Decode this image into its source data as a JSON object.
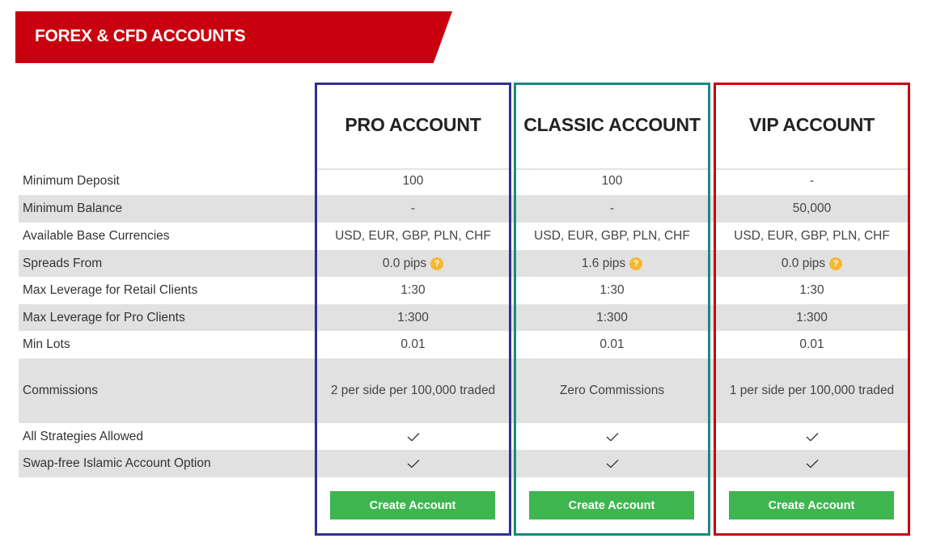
{
  "banner": {
    "title": "FOREX & CFD ACCOUNTS",
    "color": "#c9000f"
  },
  "rows": [
    {
      "key": "min_deposit",
      "label": "Minimum Deposit"
    },
    {
      "key": "min_balance",
      "label": "Minimum Balance"
    },
    {
      "key": "currencies",
      "label": "Available Base Currencies"
    },
    {
      "key": "spreads",
      "label": "Spreads From"
    },
    {
      "key": "lev_retail",
      "label": "Max Leverage for Retail Clients"
    },
    {
      "key": "lev_pro",
      "label": "Max Leverage for Pro Clients"
    },
    {
      "key": "min_lots",
      "label": "Min Lots"
    },
    {
      "key": "commissions",
      "label": "Commissions"
    },
    {
      "key": "strategies",
      "label": "All Strategies Allowed"
    },
    {
      "key": "swap_free",
      "label": "Swap-free Islamic Account Option"
    }
  ],
  "accounts": [
    {
      "id": "pro",
      "title": "PRO ACCOUNT",
      "border_color": "#2e3192",
      "values": {
        "min_deposit": "100",
        "min_balance": "-",
        "currencies": "USD, EUR, GBP, PLN, CHF",
        "spreads": "0.0 pips",
        "lev_retail": "1:30",
        "lev_pro": "1:300",
        "min_lots": "0.01",
        "commissions": "2 per side per 100,000 traded",
        "strategies": true,
        "swap_free": true
      },
      "button_label": "Create Account"
    },
    {
      "id": "classic",
      "title": "CLASSIC ACCOUNT",
      "border_color": "#1a8a80",
      "values": {
        "min_deposit": "100",
        "min_balance": "-",
        "currencies": "USD, EUR, GBP, PLN, CHF",
        "spreads": "1.6 pips",
        "lev_retail": "1:30",
        "lev_pro": "1:300",
        "min_lots": "0.01",
        "commissions": "Zero Commissions",
        "strategies": true,
        "swap_free": true
      },
      "button_label": "Create Account"
    },
    {
      "id": "vip",
      "title": "VIP ACCOUNT",
      "border_color": "#c9000f",
      "values": {
        "min_deposit": "-",
        "min_balance": "50,000",
        "currencies": "USD, EUR, GBP, PLN, CHF",
        "spreads": "0.0 pips",
        "lev_retail": "1:30",
        "lev_pro": "1:300",
        "min_lots": "0.01",
        "commissions": "1 per side per 100,000 traded",
        "strategies": true,
        "swap_free": true
      },
      "button_label": "Create Account"
    }
  ],
  "icons": {
    "help": "?",
    "check": "check-icon"
  },
  "colors": {
    "button_green": "#3fb550",
    "help_icon": "#f5b82e",
    "row_gray": "#e1e1e1"
  }
}
